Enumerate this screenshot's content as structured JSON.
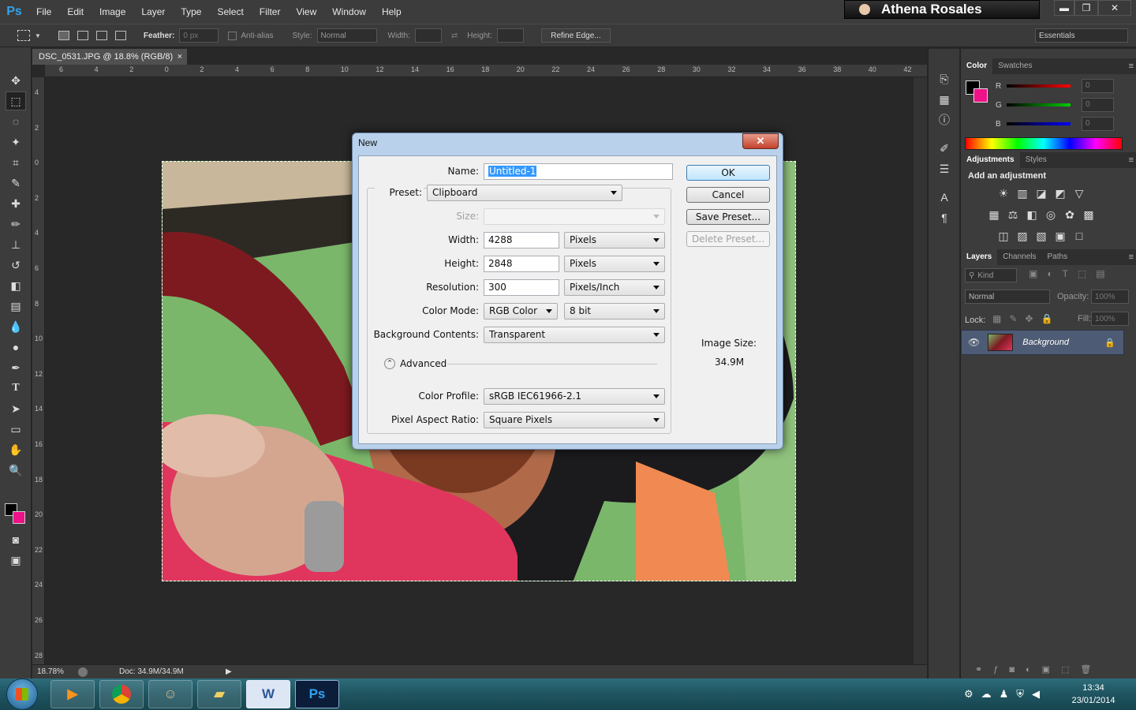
{
  "app": {
    "logo": "Ps",
    "menu": [
      "File",
      "Edit",
      "Image",
      "Layer",
      "Type",
      "Select",
      "Filter",
      "View",
      "Window",
      "Help"
    ],
    "user_name": "Athena Rosales",
    "win_min": "▬",
    "win_max": "❐",
    "win_close": "✕"
  },
  "options": {
    "feather_label": "Feather:",
    "feather_value": "0 px",
    "antialias_label": "Anti-alias",
    "style_label": "Style:",
    "style_value": "Normal",
    "width_label": "Width:",
    "height_label": "Height:",
    "refine_edge": "Refine Edge...",
    "workspace": "Essentials"
  },
  "document": {
    "tab_title": "DSC_0531.JPG @ 18.8% (RGB/8)",
    "tab_close": "×",
    "ruler_h": [
      "6",
      "4",
      "2",
      "0",
      "2",
      "4",
      "6",
      "8",
      "10",
      "12",
      "14",
      "16",
      "18",
      "20",
      "22",
      "24",
      "26",
      "28",
      "30",
      "32",
      "34",
      "36",
      "38",
      "40",
      "42"
    ],
    "ruler_v": [
      "4",
      "2",
      "0",
      "2",
      "4",
      "6",
      "8",
      "10",
      "12",
      "14",
      "16",
      "18",
      "20",
      "22",
      "24",
      "26",
      "28"
    ],
    "zoom": "18.78%",
    "doc_size": "Doc: 34.9M/34.9M"
  },
  "color_panel": {
    "tabs": [
      "Color",
      "Swatches"
    ],
    "channels": [
      {
        "label": "R",
        "value": "0"
      },
      {
        "label": "G",
        "value": "0"
      },
      {
        "label": "B",
        "value": "0"
      }
    ],
    "colors": {
      "fg": "#000000",
      "bg": "#ee1188"
    }
  },
  "adjustments_panel": {
    "tabs": [
      "Adjustments",
      "Styles"
    ],
    "title": "Add an adjustment"
  },
  "layers_panel": {
    "tabs": [
      "Layers",
      "Channels",
      "Paths"
    ],
    "kind": "Kind",
    "blend_mode": "Normal",
    "opacity_label": "Opacity:",
    "opacity_value": "100%",
    "lock_label": "Lock:",
    "fill_label": "Fill:",
    "fill_value": "100%",
    "layer_name": "Background"
  },
  "dialog": {
    "title": "New",
    "close": "✕",
    "name_label": "Name:",
    "name_value": "Untitled-1",
    "preset_label": "Preset:",
    "preset_value": "Clipboard",
    "size_label": "Size:",
    "width_label": "Width:",
    "width_value": "4288",
    "width_unit": "Pixels",
    "height_label": "Height:",
    "height_value": "2848",
    "height_unit": "Pixels",
    "resolution_label": "Resolution:",
    "resolution_value": "300",
    "resolution_unit": "Pixels/Inch",
    "color_mode_label": "Color Mode:",
    "color_mode_value": "RGB Color",
    "bit_depth_value": "8 bit",
    "background_label": "Background Contents:",
    "background_value": "Transparent",
    "advanced_label": "Advanced",
    "profile_label": "Color Profile:",
    "profile_value": "sRGB IEC61966-2.1",
    "pixel_aspect_label": "Pixel Aspect Ratio:",
    "pixel_aspect_value": "Square Pixels",
    "ok": "OK",
    "cancel": "Cancel",
    "save_preset": "Save Preset...",
    "delete_preset": "Delete Preset...",
    "image_size_label": "Image Size:",
    "image_size_value": "34.9M"
  },
  "taskbar": {
    "time": "13:34",
    "date": "23/01/2014",
    "word_icon": "W",
    "ps_icon": "Ps"
  }
}
